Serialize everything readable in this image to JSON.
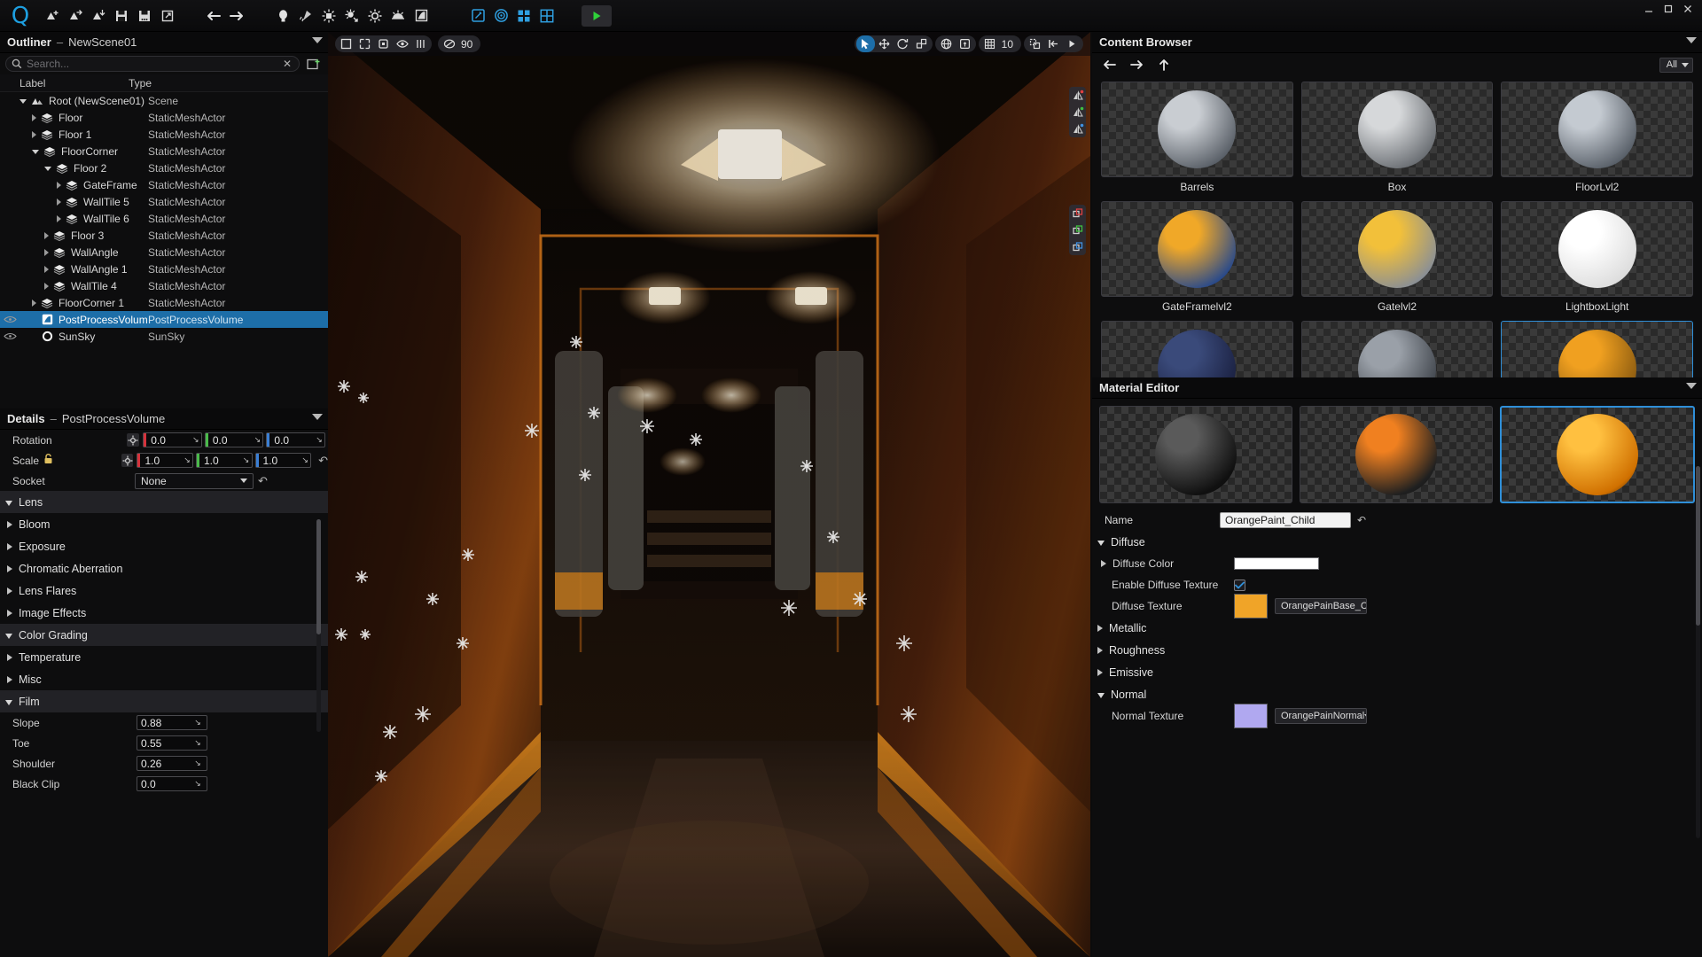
{
  "app": {
    "logo": "q-logo-icon",
    "window_controls": [
      "minimize",
      "maximize",
      "close"
    ]
  },
  "toolbar": {
    "groups": [
      {
        "name": "file",
        "items": [
          {
            "icon": "new-scene-icon",
            "label": "New Scene"
          },
          {
            "icon": "open-scene-icon",
            "label": "Open Scene"
          },
          {
            "icon": "import-scene-icon",
            "label": "Import Scene"
          },
          {
            "icon": "save-icon",
            "label": "Save"
          },
          {
            "icon": "save-as-icon",
            "label": "Save As"
          },
          {
            "icon": "export-icon",
            "label": "Export"
          }
        ]
      },
      {
        "name": "history",
        "items": [
          {
            "icon": "undo-icon",
            "label": "Undo"
          },
          {
            "icon": "redo-icon",
            "label": "Redo"
          }
        ]
      },
      {
        "name": "lights",
        "items": [
          {
            "icon": "point-light-icon",
            "label": "Point Light"
          },
          {
            "icon": "spot-light-icon",
            "label": "Spot Light"
          },
          {
            "icon": "area-light-icon",
            "label": "Area Light"
          },
          {
            "icon": "directional-light-icon",
            "label": "Directional Light"
          },
          {
            "icon": "sun-light-icon",
            "label": "Sun Light"
          },
          {
            "icon": "sky-light-icon",
            "label": "Sky Light"
          },
          {
            "icon": "reflection-probe-icon",
            "label": "Reflection Probe"
          }
        ]
      },
      {
        "name": "editors",
        "items": [
          {
            "icon": "material-edit-icon",
            "label": "Material Editor"
          },
          {
            "icon": "lookdev-icon",
            "label": "LookDev"
          },
          {
            "icon": "layout-grid-icon",
            "label": "Layout"
          },
          {
            "icon": "layout-quad-icon",
            "label": "Quad Layout"
          }
        ]
      },
      {
        "name": "play",
        "items": [
          {
            "icon": "play-icon",
            "label": "Play"
          }
        ]
      }
    ]
  },
  "outliner": {
    "title": "Outliner",
    "scene_name": "NewScene01",
    "search": {
      "placeholder": "Search...",
      "value": "",
      "clear_icon": "close-icon",
      "search_icon": "search-icon"
    },
    "add_button_icon": "add-actor-icon",
    "columns": [
      "Label",
      "Type"
    ],
    "rows": [
      {
        "label": "Root (NewScene01)",
        "type": "Scene",
        "depth": 0,
        "state": "open",
        "icon": "scene-icon",
        "selected": false,
        "eye": false
      },
      {
        "label": "Floor",
        "type": "StaticMeshActor",
        "depth": 1,
        "state": "closed",
        "icon": "mesh-icon",
        "selected": false,
        "eye": false
      },
      {
        "label": "Floor 1",
        "type": "StaticMeshActor",
        "depth": 1,
        "state": "closed",
        "icon": "mesh-icon",
        "selected": false,
        "eye": false
      },
      {
        "label": "FloorCorner",
        "type": "StaticMeshActor",
        "depth": 1,
        "state": "open",
        "icon": "mesh-icon",
        "selected": false,
        "eye": false
      },
      {
        "label": "Floor 2",
        "type": "StaticMeshActor",
        "depth": 2,
        "state": "open",
        "icon": "mesh-icon",
        "selected": false,
        "eye": false
      },
      {
        "label": "GateFrame",
        "type": "StaticMeshActor",
        "depth": 3,
        "state": "closed",
        "icon": "mesh-icon",
        "selected": false,
        "eye": false
      },
      {
        "label": "WallTile 5",
        "type": "StaticMeshActor",
        "depth": 3,
        "state": "closed",
        "icon": "mesh-icon",
        "selected": false,
        "eye": false
      },
      {
        "label": "WallTile 6",
        "type": "StaticMeshActor",
        "depth": 3,
        "state": "closed",
        "icon": "mesh-icon",
        "selected": false,
        "eye": false
      },
      {
        "label": "Floor 3",
        "type": "StaticMeshActor",
        "depth": 2,
        "state": "closed",
        "icon": "mesh-icon",
        "selected": false,
        "eye": false
      },
      {
        "label": "WallAngle",
        "type": "StaticMeshActor",
        "depth": 2,
        "state": "closed",
        "icon": "mesh-icon",
        "selected": false,
        "eye": false
      },
      {
        "label": "WallAngle 1",
        "type": "StaticMeshActor",
        "depth": 2,
        "state": "closed",
        "icon": "mesh-icon",
        "selected": false,
        "eye": false
      },
      {
        "label": "WallTile 4",
        "type": "StaticMeshActor",
        "depth": 2,
        "state": "closed",
        "icon": "mesh-icon",
        "selected": false,
        "eye": false
      },
      {
        "label": "FloorCorner 1",
        "type": "StaticMeshActor",
        "depth": 1,
        "state": "closed",
        "icon": "mesh-icon",
        "selected": false,
        "eye": false
      },
      {
        "label": "PostProcessVolume",
        "type": "PostProcessVolume",
        "depth": 1,
        "state": "none",
        "icon": "volume-icon",
        "selected": true,
        "eye": true
      },
      {
        "label": "SunSky",
        "type": "SunSky",
        "depth": 1,
        "state": "none",
        "icon": "sunsky-icon",
        "selected": false,
        "eye": true
      }
    ]
  },
  "details": {
    "title": "Details",
    "subject": "PostProcessVolume",
    "transform": [
      {
        "label": "Rotation",
        "locked": false,
        "x": "0.0",
        "y": "0.0",
        "z": "0.0",
        "has_reset": false
      },
      {
        "label": "Scale",
        "locked": true,
        "x": "1.0",
        "y": "1.0",
        "z": "1.0",
        "has_reset": true
      }
    ],
    "socket": {
      "label": "Socket",
      "value": "None",
      "has_reset": true
    },
    "sections": [
      {
        "label": "Lens",
        "kind": "group",
        "state": "open"
      },
      {
        "label": "Bloom",
        "kind": "sub",
        "state": "closed"
      },
      {
        "label": "Exposure",
        "kind": "sub",
        "state": "closed"
      },
      {
        "label": "Chromatic Aberration",
        "kind": "sub",
        "state": "closed"
      },
      {
        "label": "Lens Flares",
        "kind": "sub",
        "state": "closed"
      },
      {
        "label": "Image Effects",
        "kind": "sub",
        "state": "closed"
      },
      {
        "label": "Color Grading",
        "kind": "group",
        "state": "open"
      },
      {
        "label": "Temperature",
        "kind": "sub",
        "state": "closed"
      },
      {
        "label": "Misc",
        "kind": "sub",
        "state": "closed"
      },
      {
        "label": "Film",
        "kind": "group",
        "state": "open"
      }
    ],
    "film_values": [
      {
        "label": "Slope",
        "value": "0.88"
      },
      {
        "label": "Toe",
        "value": "0.55"
      },
      {
        "label": "Shoulder",
        "value": "0.26"
      },
      {
        "label": "Black Clip",
        "value": "0.0"
      }
    ],
    "axis_colors": {
      "x": "#d6323b",
      "y": "#4aba4a",
      "z": "#3a7fd5"
    }
  },
  "viewport": {
    "left_tools": [
      {
        "icon": "select-box-icon",
        "active": false
      },
      {
        "icon": "crop-icon",
        "active": false
      },
      {
        "icon": "frame-icon",
        "active": false
      },
      {
        "icon": "eye-icon",
        "active": false
      },
      {
        "icon": "measure-icon",
        "active": false
      },
      {
        "icon": "camera-fov-icon",
        "active": false,
        "value": "90"
      }
    ],
    "right_tools": [
      {
        "icon": "cursor-select-icon",
        "active": true
      },
      {
        "icon": "move-gizmo-icon",
        "active": false
      },
      {
        "icon": "rotate-gizmo-icon",
        "active": false
      },
      {
        "icon": "scale-gizmo-icon",
        "active": false
      },
      {
        "icon": "world-space-icon",
        "active": false
      },
      {
        "icon": "local-space-icon",
        "active": false
      },
      {
        "icon": "grid-snap-icon",
        "active": false,
        "value": "10"
      },
      {
        "icon": "surface-snap-icon",
        "active": false
      },
      {
        "icon": "pivot-snap-icon",
        "active": false
      },
      {
        "icon": "snap-settings-icon",
        "active": false
      }
    ],
    "side_tools_mirror": [
      {
        "icon": "mirror-x-icon",
        "color": "#e04040"
      },
      {
        "icon": "mirror-y-icon",
        "color": "#40c040"
      },
      {
        "icon": "mirror-z-icon",
        "color": "#4090e0"
      }
    ],
    "side_tools_duplicate": [
      {
        "icon": "duplicate-x-icon",
        "color": "#e04040"
      },
      {
        "icon": "duplicate-y-icon",
        "color": "#40c040"
      },
      {
        "icon": "duplicate-z-icon",
        "color": "#4090e0"
      }
    ],
    "fov": "90",
    "grid_size": "10"
  },
  "content_browser": {
    "title": "Content Browser",
    "nav": [
      {
        "icon": "back-arrow-icon"
      },
      {
        "icon": "forward-arrow-icon"
      },
      {
        "icon": "up-arrow-icon"
      }
    ],
    "filter": {
      "label": "All",
      "caret_icon": "chevron-down-icon"
    },
    "assets": [
      {
        "label": "Barrels",
        "color1": "#c9cdd2",
        "color2": "#5a6068",
        "selected": false
      },
      {
        "label": "Box",
        "color1": "#d6d8da",
        "color2": "#6b6f74",
        "selected": false
      },
      {
        "label": "FloorLvl2",
        "color1": "#c4cad1",
        "color2": "#596069",
        "selected": false
      },
      {
        "label": "GateFramelvl2",
        "color1": "#f0a828",
        "color2": "#2a4a8a",
        "selected": false
      },
      {
        "label": "Gatelvl2",
        "color1": "#f2c03a",
        "color2": "#8a8f95",
        "selected": false
      },
      {
        "label": "LightboxLight",
        "color1": "#ffffff",
        "color2": "#dddddd",
        "selected": false
      },
      {
        "label": "",
        "color1": "#3a4a7a",
        "color2": "#1a2040",
        "selected": false
      },
      {
        "label": "",
        "color1": "#9aa0a8",
        "color2": "#40454c",
        "selected": false
      },
      {
        "label": "",
        "color1": "#f0a020",
        "color2": "#8a5a10",
        "selected": true
      }
    ]
  },
  "material_editor": {
    "title": "Material Editor",
    "previews": [
      {
        "name": "black-marble-material",
        "c1": "#5a5a5a",
        "c2": "#101010",
        "selected": false
      },
      {
        "name": "orange-stripe-material",
        "c1": "#f08020",
        "c2": "#202020",
        "selected": false
      },
      {
        "name": "orange-paint-material",
        "c1": "#ffc040",
        "c2": "#d07000",
        "selected": true
      }
    ],
    "name_field": {
      "label": "Name",
      "value": "OrangePaint_Child",
      "reset_icon": "revert-icon"
    },
    "sections": [
      {
        "label": "Diffuse",
        "state": "open",
        "props": [
          {
            "kind": "color",
            "label": "Diffuse Color",
            "expandable": true,
            "value": "#ffffff"
          },
          {
            "kind": "checkbox",
            "label": "Enable Diffuse Texture",
            "checked": true,
            "accent": "#2f8fd8"
          },
          {
            "kind": "texture",
            "label": "Diffuse Texture",
            "swatch": "#f0a428",
            "dropdown": "OrangePainBase_C"
          }
        ]
      },
      {
        "label": "Metallic",
        "state": "closed",
        "props": []
      },
      {
        "label": "Roughness",
        "state": "closed",
        "props": []
      },
      {
        "label": "Emissive",
        "state": "closed",
        "props": []
      },
      {
        "label": "Normal",
        "state": "open",
        "props": [
          {
            "kind": "texture",
            "label": "Normal Texture",
            "swatch": "#b0a8f0",
            "dropdown": "OrangePainNormal"
          }
        ]
      }
    ]
  },
  "colors": {
    "accent": "#1d6ea8",
    "select_blue": "#2f8fd8",
    "panel_bg": "#0d0d0e",
    "header_bg": "#0a0a0b"
  }
}
